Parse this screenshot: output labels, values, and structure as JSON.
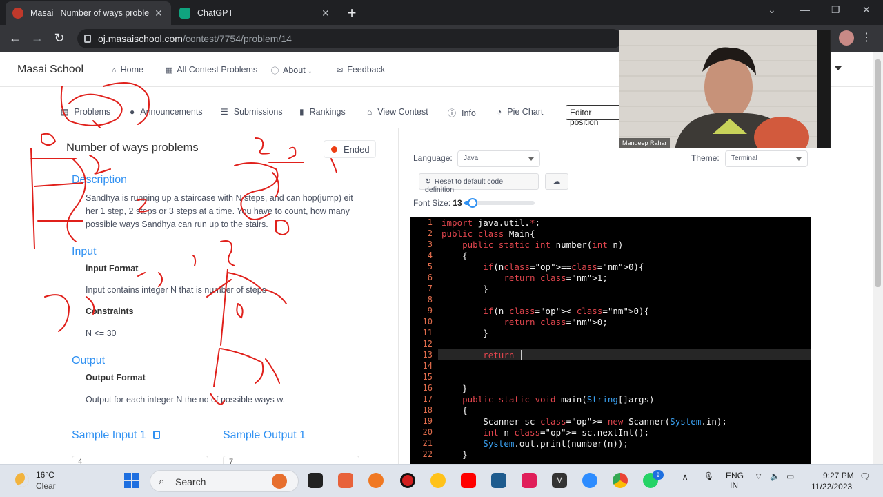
{
  "browser": {
    "tabs": [
      {
        "title": "Masai | Number of ways proble",
        "active": true
      },
      {
        "title": "ChatGPT",
        "active": false
      }
    ],
    "url_host": "oj.masaischool.com",
    "url_path": "/contest/7754/problem/14"
  },
  "site": {
    "brand": "Masai School",
    "nav": [
      "Home",
      "All Contest Problems",
      "About",
      "Feedback"
    ]
  },
  "subnav": {
    "items": [
      "Problems",
      "Announcements",
      "Submissions",
      "Rankings",
      "View Contest",
      "Info",
      "Pie Chart"
    ],
    "editor_position": "Editor position"
  },
  "problem": {
    "title": "Number of ways problems",
    "status": "Ended",
    "description_heading": "Description",
    "description_lines": [
      "Sandhya is running up a staircase with N steps, and can hop(jump) eit",
      "her 1 step, 2 steps or 3 steps at a time. You have to count, how many",
      "possible ways Sandhya can run up to the stairs."
    ],
    "input_heading": "Input",
    "input_format_label": "input Format",
    "input_format": "Input contains integer N that is number of steps",
    "constraints_label": "Constraints",
    "constraints": "N <= 30",
    "output_heading": "Output",
    "output_format_label": "Output Format",
    "output_format": "Output for each integer N the no of possible ways w.",
    "sample_input_label": "Sample Input 1",
    "sample_output_label": "Sample Output 1",
    "sample_input_value": "4",
    "sample_output_value": "7"
  },
  "editor_panel": {
    "language_label": "Language:",
    "language": "Java",
    "theme_label": "Theme:",
    "theme": "Terminal",
    "reset_label": "Reset to default code definition",
    "font_size_label": "Font Size:",
    "font_size": "13",
    "font_slider_fraction": 0.12,
    "current_line": 13
  },
  "code_lines": [
    "import java.util.*;",
    "public class Main{",
    "    public static int number(int n)",
    "    {",
    "        if(n==0){",
    "            return 1;",
    "        }",
    "",
    "        if(n < 0){",
    "            return 0;",
    "        }",
    "",
    "        return ",
    "",
    "",
    "    }",
    "    public static void main(String[]args)",
    "    {",
    "        Scanner sc = new Scanner(System.in);",
    "        int n = sc.nextInt();",
    "        System.out.print(number(n));",
    "    }"
  ],
  "webcam": {
    "name": "Mandeep Rahar"
  },
  "taskbar": {
    "temperature": "16°C",
    "weather": "Clear",
    "search_label": "Search",
    "language": "ENG",
    "region": "IN",
    "time": "9:27 PM",
    "date": "11/22/2023",
    "whatsapp_badge": "9"
  },
  "colors": {
    "accent": "#3091f2",
    "status_red": "#ed3f14",
    "annotation_red": "#e0201b"
  }
}
